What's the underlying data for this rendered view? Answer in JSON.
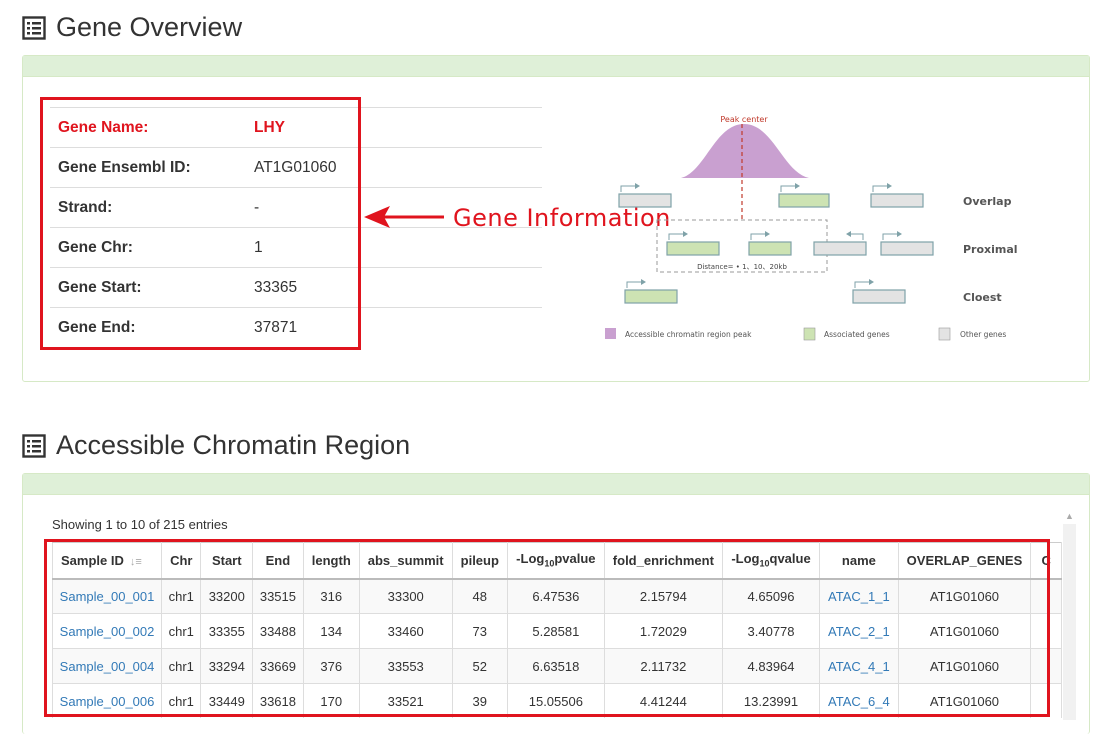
{
  "sections": {
    "overview_title": "Gene Overview",
    "acr_title": "Accessible Chromatin Region"
  },
  "gene": {
    "rows": [
      {
        "key": "Gene Name:",
        "value": "LHY"
      },
      {
        "key": "Gene Ensembl ID:",
        "value": "AT1G01060"
      },
      {
        "key": "Strand:",
        "value": "-"
      },
      {
        "key": "Gene Chr:",
        "value": "1"
      },
      {
        "key": "Gene Start:",
        "value": "33365"
      },
      {
        "key": "Gene End:",
        "value": "37871"
      }
    ]
  },
  "annotation": {
    "label": "Gene Information",
    "color": "#e0141e"
  },
  "diagram": {
    "peak_label": "Peak center",
    "row_labels": [
      "Overlap",
      "Proximal",
      "Cloest"
    ],
    "distance_label": "Distance= • 1、10、20kb",
    "legend": [
      "Accessible chromatin region peak",
      "Associated genes",
      "Other genes"
    ],
    "colors": {
      "peak": "#c9a0d0",
      "associated": "#cde3b3",
      "other": "#e3e3e3"
    }
  },
  "acr": {
    "entries_info": "Showing 1 to 10 of 215 entries",
    "headers": [
      "Sample ID",
      "Chr",
      "Start",
      "End",
      "length",
      "abs_summit",
      "pileup",
      "-Log10pvalue",
      "fold_enrichment",
      "-Log10qvalue",
      "name",
      "OVERLAP_GENES",
      "C"
    ],
    "rows": [
      [
        "Sample_00_001",
        "chr1",
        "33200",
        "33515",
        "316",
        "33300",
        "48",
        "6.47536",
        "2.15794",
        "4.65096",
        "ATAC_1_1",
        "AT1G01060"
      ],
      [
        "Sample_00_002",
        "chr1",
        "33355",
        "33488",
        "134",
        "33460",
        "73",
        "5.28581",
        "1.72029",
        "3.40778",
        "ATAC_2_1",
        "AT1G01060"
      ],
      [
        "Sample_00_004",
        "chr1",
        "33294",
        "33669",
        "376",
        "33553",
        "52",
        "6.63518",
        "2.11732",
        "4.83964",
        "ATAC_4_1",
        "AT1G01060"
      ],
      [
        "Sample_00_006",
        "chr1",
        "33449",
        "33618",
        "170",
        "33521",
        "39",
        "15.05506",
        "4.41244",
        "13.23991",
        "ATAC_6_4",
        "AT1G01060"
      ]
    ]
  }
}
